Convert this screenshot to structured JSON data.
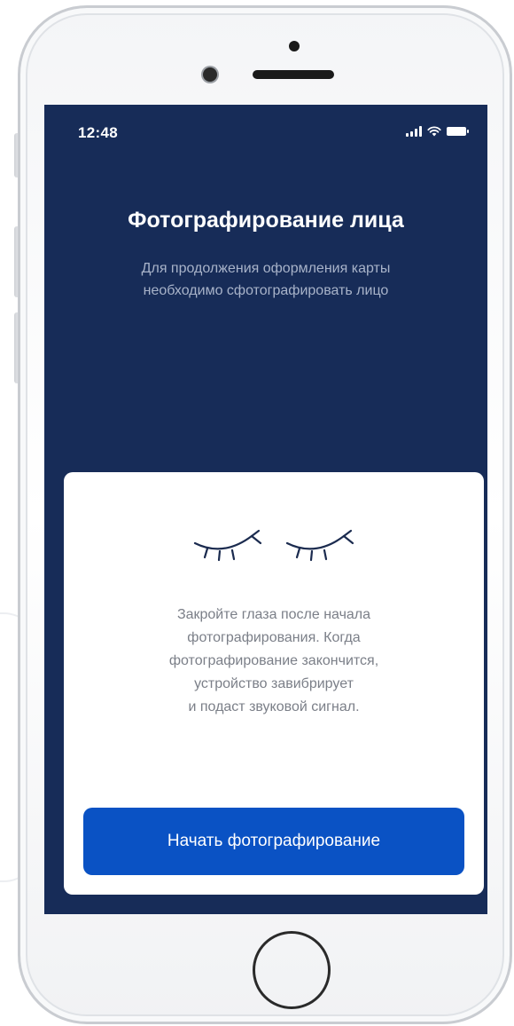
{
  "status_bar": {
    "time": "12:48",
    "icons": [
      "signal-icon",
      "wifi-icon",
      "battery-icon"
    ]
  },
  "screen": {
    "title": "Фотографирование лица",
    "subtitle": "Для продолжения оформления карты необходимо сфотографировать лицо"
  },
  "card": {
    "illustration": "closed-eyes-icon",
    "instruction": "Закройте глаза после начала\nфотографирования. Когда\nфотографирование закончится,\nустройство завибрирует\nи подаст звуковой сигнал.",
    "button_label": "Начать фотографирование"
  },
  "colors": {
    "screen_background": "#172c58",
    "button_background": "#0a52c4",
    "card_background": "#ffffff",
    "subtitle_text": "#a8b3c9",
    "body_text": "#7b7f88"
  }
}
